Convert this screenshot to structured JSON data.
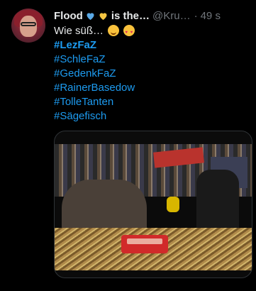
{
  "tweet": {
    "author": {
      "name": "Flood",
      "name_suffix": "is the…",
      "handle": "@Kru…",
      "time_separator": "·",
      "time": "49 s"
    },
    "text_lines": [
      "Wie süß…",
      "#LezFaZ",
      "#SchleFaZ",
      "#GedenkFaZ",
      "#RainerBasedow",
      "#TolleTanten",
      "#Sägefisch"
    ],
    "emojis": [
      "smiling-face-with-smiling-eyes",
      "smiling-face-with-heart-eyes"
    ],
    "heart_colors": [
      "#5aa9e6",
      "#f4c542"
    ],
    "colors": {
      "background": "#000000",
      "text": "#e7e9ea",
      "muted": "#71767b",
      "hashtag": "#1d9bf0"
    }
  }
}
